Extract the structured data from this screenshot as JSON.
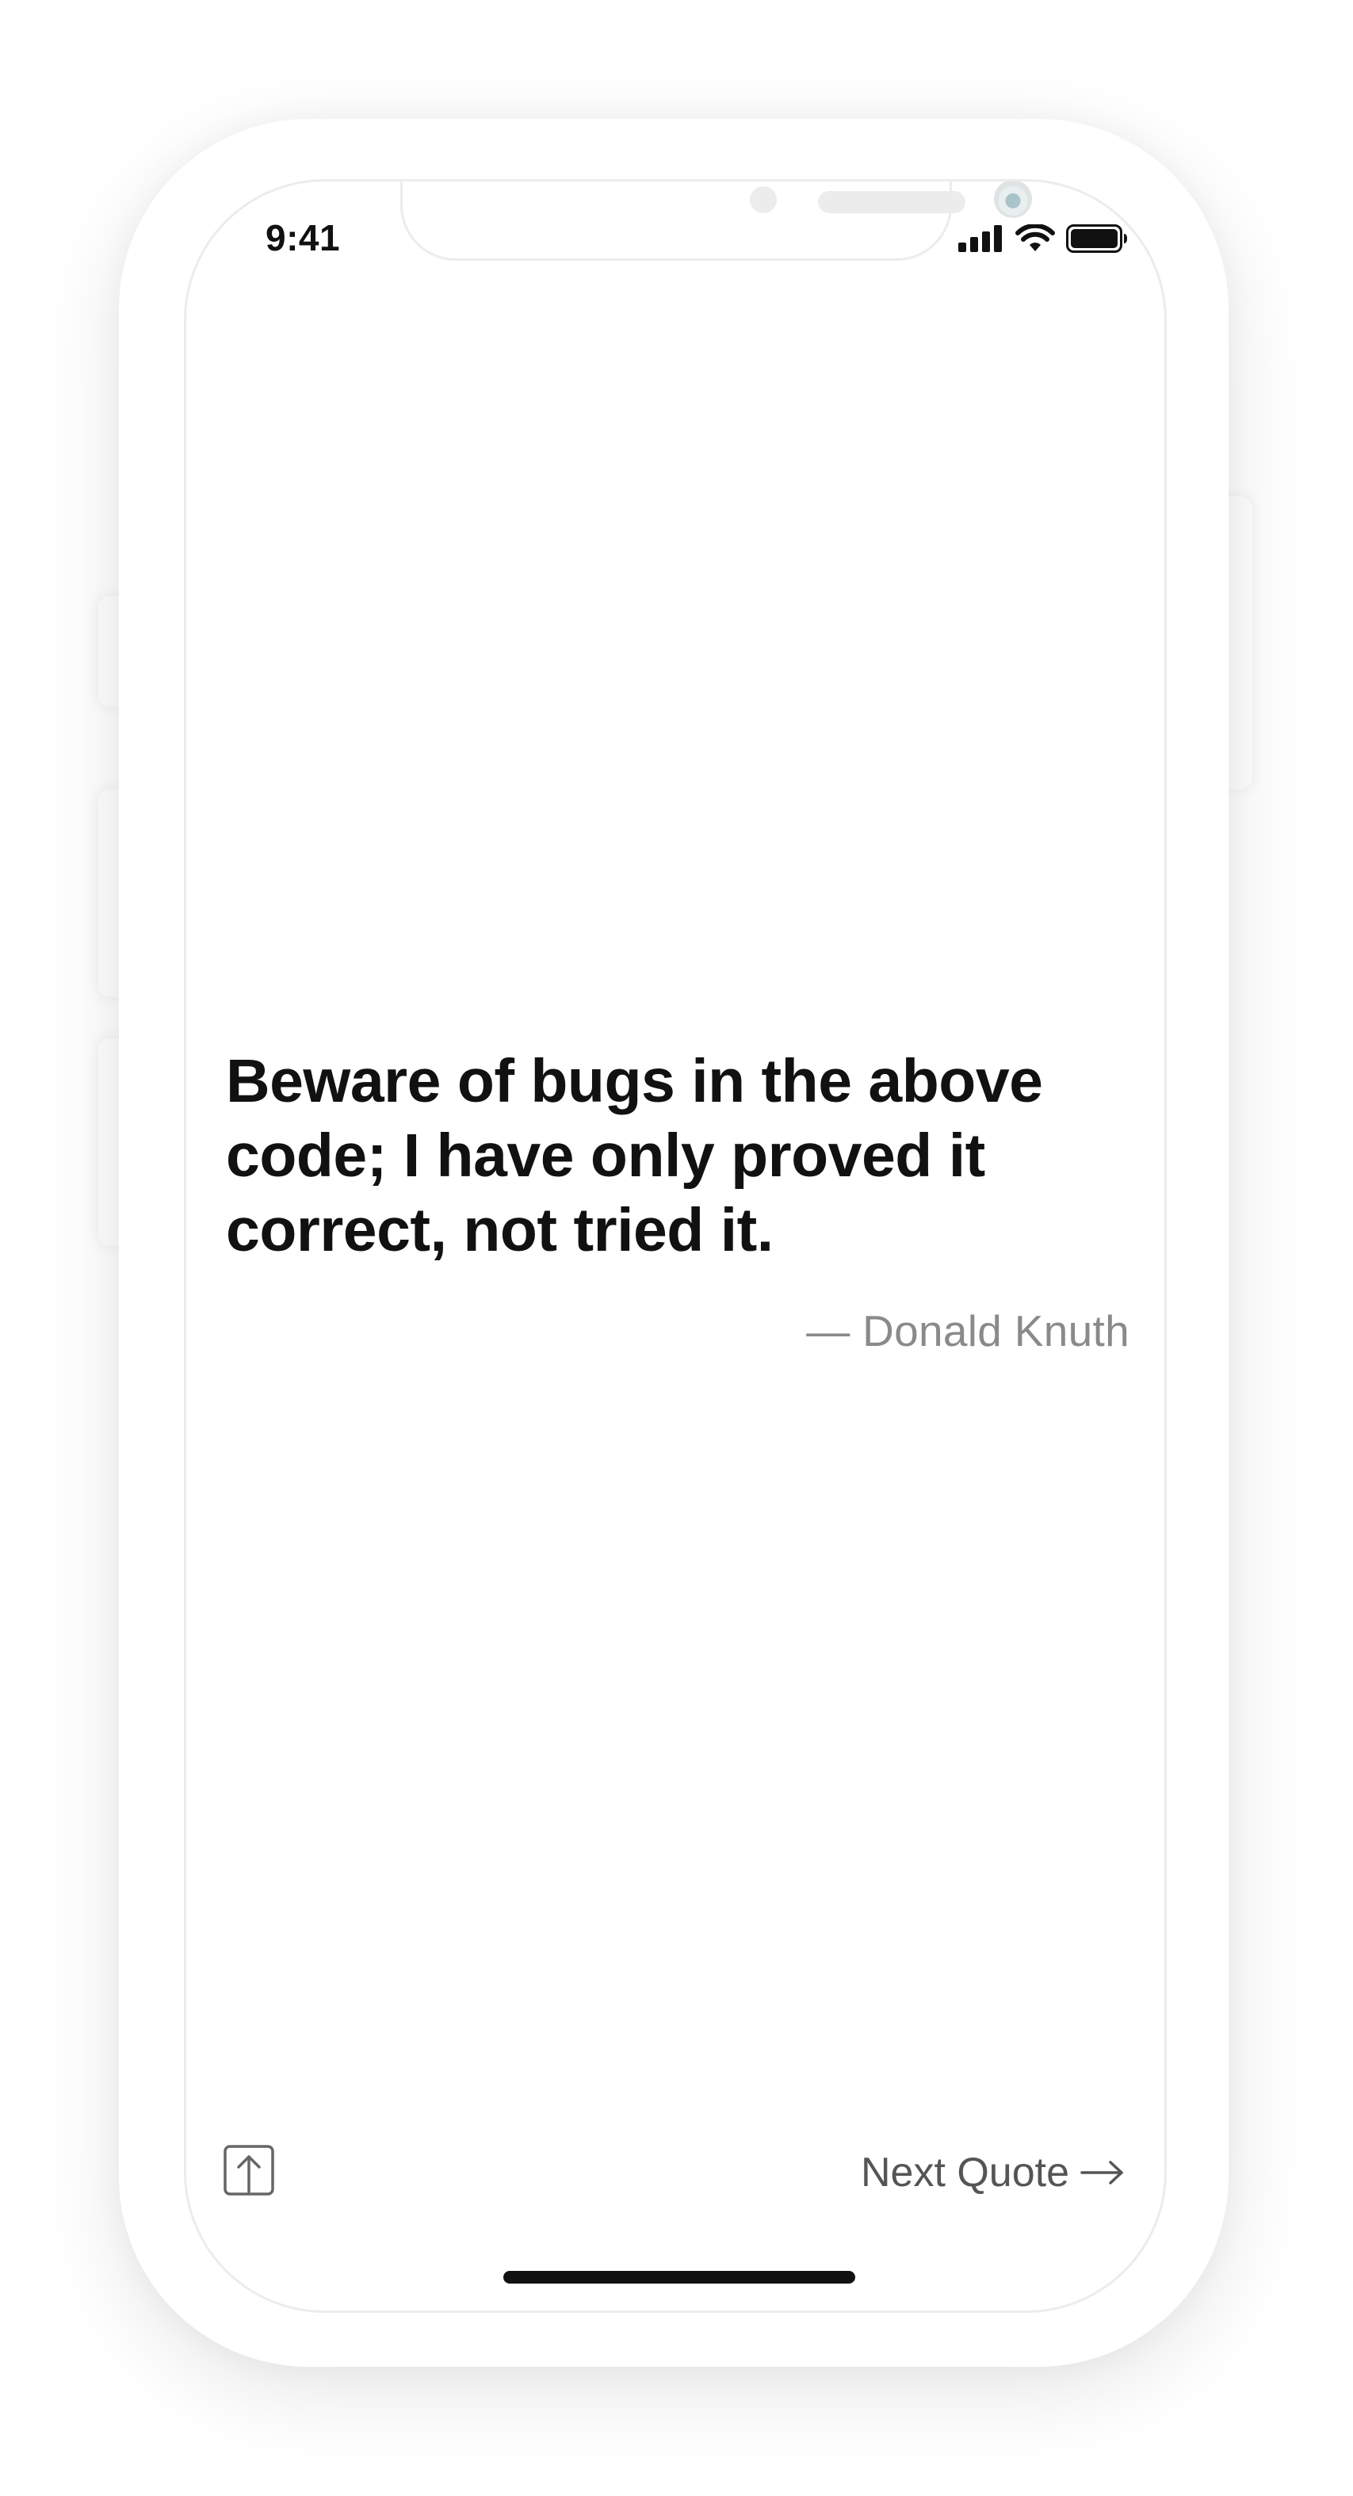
{
  "status_bar": {
    "time": "9:41",
    "icons": [
      "cellular-signal-icon",
      "wifi-icon",
      "battery-icon"
    ]
  },
  "quote": {
    "text": "Beware of bugs in the above code; I have only proved it correct, not tried it.",
    "author": "— Donald Knuth"
  },
  "toolbar": {
    "share_icon": "share-icon",
    "next_label": "Next Quote",
    "next_icon": "arrow-right-icon"
  },
  "colors": {
    "text_primary": "#111111",
    "text_secondary": "#8a8a8a",
    "button_text": "#555555",
    "background": "#ffffff",
    "device_frame": "#ececec"
  }
}
